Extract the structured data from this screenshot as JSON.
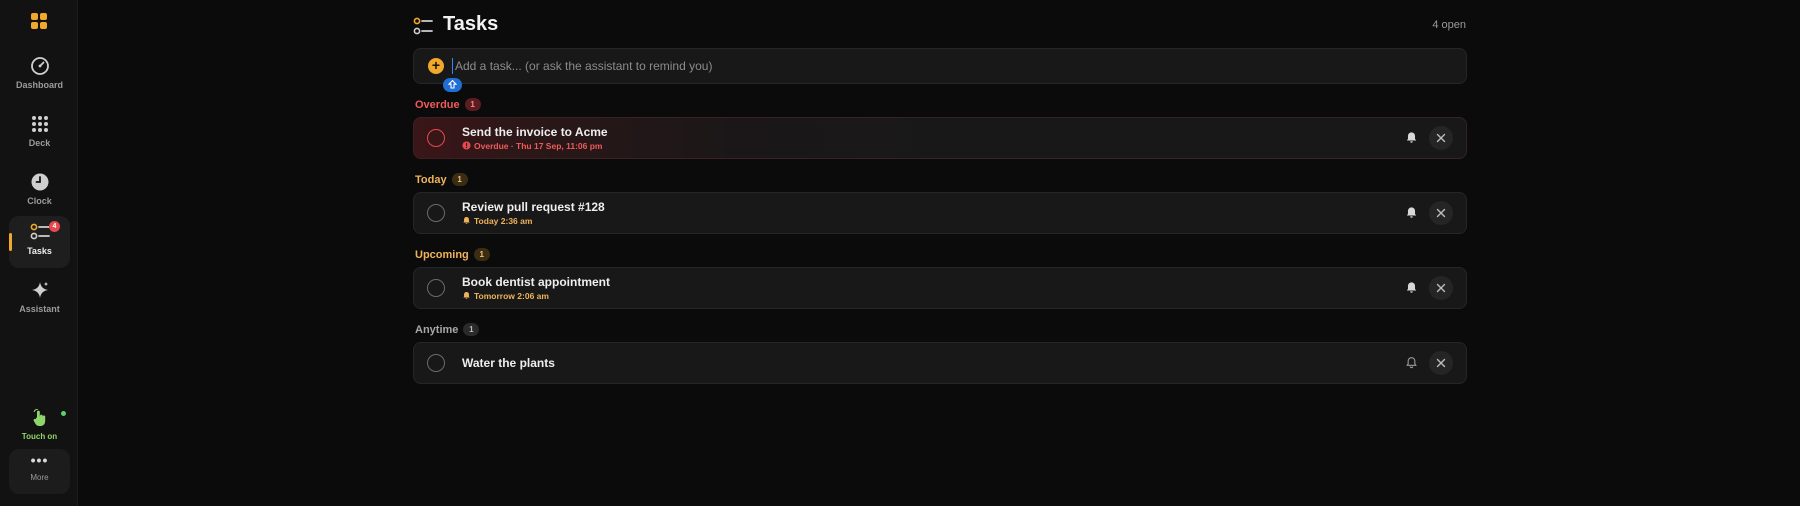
{
  "sidebar": {
    "items": [
      {
        "label": "Dashboard",
        "icon": "gauge-icon"
      },
      {
        "label": "Deck",
        "icon": "grid-icon"
      },
      {
        "label": "Clock",
        "icon": "clock-icon"
      },
      {
        "label": "Tasks",
        "icon": "checklist-icon",
        "active": true,
        "badge": "4"
      },
      {
        "label": "Assistant",
        "icon": "sparkle-icon"
      }
    ],
    "touch_label": "Touch on",
    "more_label": "More"
  },
  "header": {
    "title": "Tasks",
    "open_count": "4 open"
  },
  "add_task": {
    "placeholder": "Add a task... (or ask the assistant to remind you)",
    "value": ""
  },
  "sections": [
    {
      "name": "Overdue",
      "count": "1",
      "color": "#f05a5a",
      "tasks": [
        {
          "title": "Send the invoice to Acme",
          "meta": "Overdue · Thu 17 Sep, 11:06 pm",
          "meta_color": "#f05a5a",
          "bell": "filled"
        }
      ]
    },
    {
      "name": "Today",
      "count": "1",
      "color": "#f0b35a",
      "tasks": [
        {
          "title": "Review pull request #128",
          "meta": "Today 2:36 am",
          "meta_color": "#f0b35a",
          "bell": "filled"
        }
      ]
    },
    {
      "name": "Upcoming",
      "count": "1",
      "color": "#f0b35a",
      "tasks": [
        {
          "title": "Book dentist appointment",
          "meta": "Tomorrow 2:06 am",
          "meta_color": "#f0b35a",
          "bell": "filled"
        }
      ]
    },
    {
      "name": "Anytime",
      "count": "1",
      "color": "#a8a8a8",
      "tasks": [
        {
          "title": "Water the plants",
          "meta": "",
          "bell": "outline"
        }
      ]
    }
  ],
  "colors": {
    "accent": "#f0a92a",
    "danger": "#e5484d",
    "touch_green": "#8fd56b"
  }
}
